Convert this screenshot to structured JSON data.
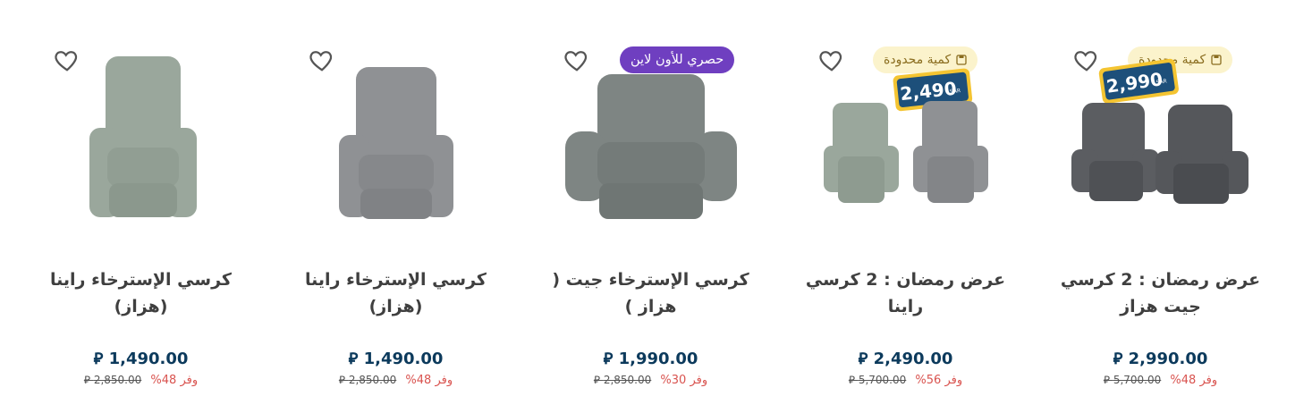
{
  "currency": "⃁",
  "products": [
    {
      "title": "عرض رمضان : 2 كرسي جيت هزاز",
      "price": "2,990.00",
      "old_price": "5,700.00",
      "save": "وفر 48%",
      "badge": {
        "type": "limited",
        "label": "كمية محدودة"
      },
      "price_tag": "2,990",
      "image": "two-dark-gray-recliners"
    },
    {
      "title": "عرض رمضان : 2 كرسي راينا",
      "price": "2,490.00",
      "old_price": "5,700.00",
      "save": "وفر 56%",
      "badge": {
        "type": "limited",
        "label": "كمية محدودة"
      },
      "price_tag": "2,490",
      "image": "green-and-gray-recliners"
    },
    {
      "title": "كرسي الإسترخاء جيت ( هزاز )",
      "price": "1,990.00",
      "old_price": "2,850.00",
      "save": "وفر 30%",
      "badge": {
        "type": "online",
        "label": "حصري للأون لاين"
      },
      "image": "gray-recliner-wide"
    },
    {
      "title": "كرسي الإسترخاء راينا (هزاز)",
      "price": "1,490.00",
      "old_price": "2,850.00",
      "save": "وفر 48%",
      "image": "gray-recliner"
    },
    {
      "title": "كرسي الإسترخاء راينا (هزاز)",
      "price": "1,490.00",
      "old_price": "2,850.00",
      "save": "وفر 48%",
      "image": "green-recliner"
    }
  ],
  "colors": {
    "price": "#0c3a5c",
    "save": "#d9534f",
    "limited_bg": "#fbf3cc",
    "online_bg": "#6f3fc0",
    "green_fabric": "#9aa79c",
    "gray_fabric": "#8f9194",
    "dark_fabric": "#5b5d61"
  }
}
